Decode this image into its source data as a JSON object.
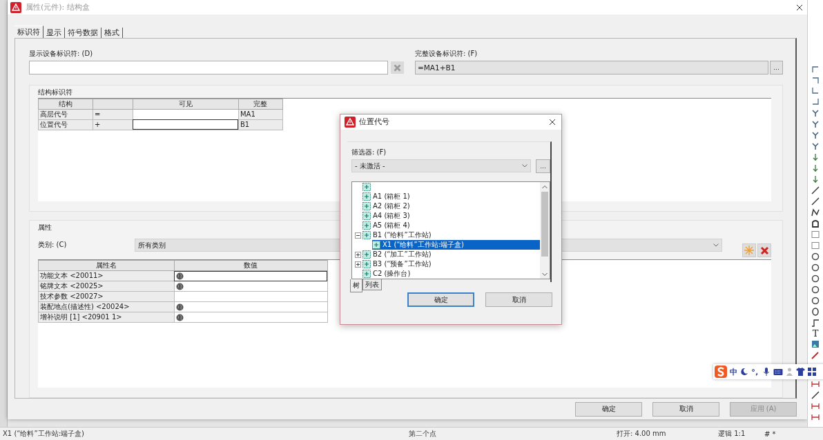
{
  "window": {
    "title": "属性(元件): 结构盒"
  },
  "tabs": [
    {
      "label": "标识符",
      "selected": true
    },
    {
      "label": "显示",
      "selected": false
    },
    {
      "label": "符号数据",
      "selected": false
    },
    {
      "label": "格式",
      "selected": false
    }
  ],
  "display_identifier": {
    "label": "显示设备标识符: (D)"
  },
  "full_identifier": {
    "label": "完整设备标识符: (F)",
    "value": "=MA1+B1",
    "button": "..."
  },
  "structure": {
    "title": "结构标识符",
    "columns": {
      "column_1": "结构",
      "column_3": "可见",
      "column_4": "完整"
    },
    "rows": [
      {
        "column_1": "高层代号",
        "column_2": "=",
        "column_4": "MA1",
        "focused": false
      },
      {
        "column_1": "位置代号",
        "column_2": "+",
        "column_4": "B1",
        "focused": true
      }
    ]
  },
  "properties": {
    "title": "属性",
    "category_label": "类别: (C)",
    "category_value": "所有类别",
    "columns": [
      "属性名",
      "数值"
    ],
    "rows": [
      {
        "name": "功能文本 <20011>",
        "globe": true,
        "focused": true
      },
      {
        "name": "铭牌文本 <20025>",
        "globe": true,
        "focused": false
      },
      {
        "name": "技术参数 <20027>",
        "globe": false,
        "focused": false
      },
      {
        "name": "装配地点(描述性) <20024>",
        "globe": true,
        "focused": false
      },
      {
        "name": "增补说明 [1] <20901 1>",
        "globe": true,
        "focused": false
      }
    ]
  },
  "buttons": [
    {
      "label": "确定",
      "disabled": false
    },
    {
      "label": "取消",
      "disabled": false
    },
    {
      "label": "应用 (A)",
      "disabled": true
    }
  ],
  "dialog": {
    "title": "位置代号",
    "filter_label": "筛选器: (F)",
    "filter_value": "- 未激活 -",
    "filter_button": "...",
    "tree": [
      {
        "selected": false
      },
      {
        "label": "A1 (箱柜 1)",
        "selected": false
      },
      {
        "label": "A2 (箱柜 2)",
        "selected": false
      },
      {
        "label": "A4 (箱柜 3)",
        "selected": false
      },
      {
        "label": "A5 (箱柜 4)",
        "selected": false
      },
      {
        "label": "B1 (“给料”工作站)",
        "selected": false,
        "expanded": true,
        "children": [
          {
            "label": "X1 (“给料”工作站:端子盒)",
            "selected": true
          }
        ]
      },
      {
        "label": "B2 (“加工”工作站)",
        "selected": false,
        "expanded": false
      },
      {
        "label": "B3 (“预备”工作站)",
        "selected": false,
        "expanded": false
      },
      {
        "label": "C2 (操作台)",
        "selected": false
      }
    ],
    "view_tabs": [
      {
        "label": "树",
        "selected": true
      },
      {
        "label": "列表",
        "selected": false
      }
    ],
    "buttons": [
      {
        "label": "确定",
        "focused": true
      },
      {
        "label": "取消",
        "focused": false
      }
    ]
  },
  "toolbar_text": "T",
  "ime": {
    "label": "中"
  },
  "status_bar": [
    "X1 (“给料”工作站:端子盒)",
    "第二个点",
    "打开: 4.00 mm",
    "逻辑 1:1",
    "# *"
  ]
}
